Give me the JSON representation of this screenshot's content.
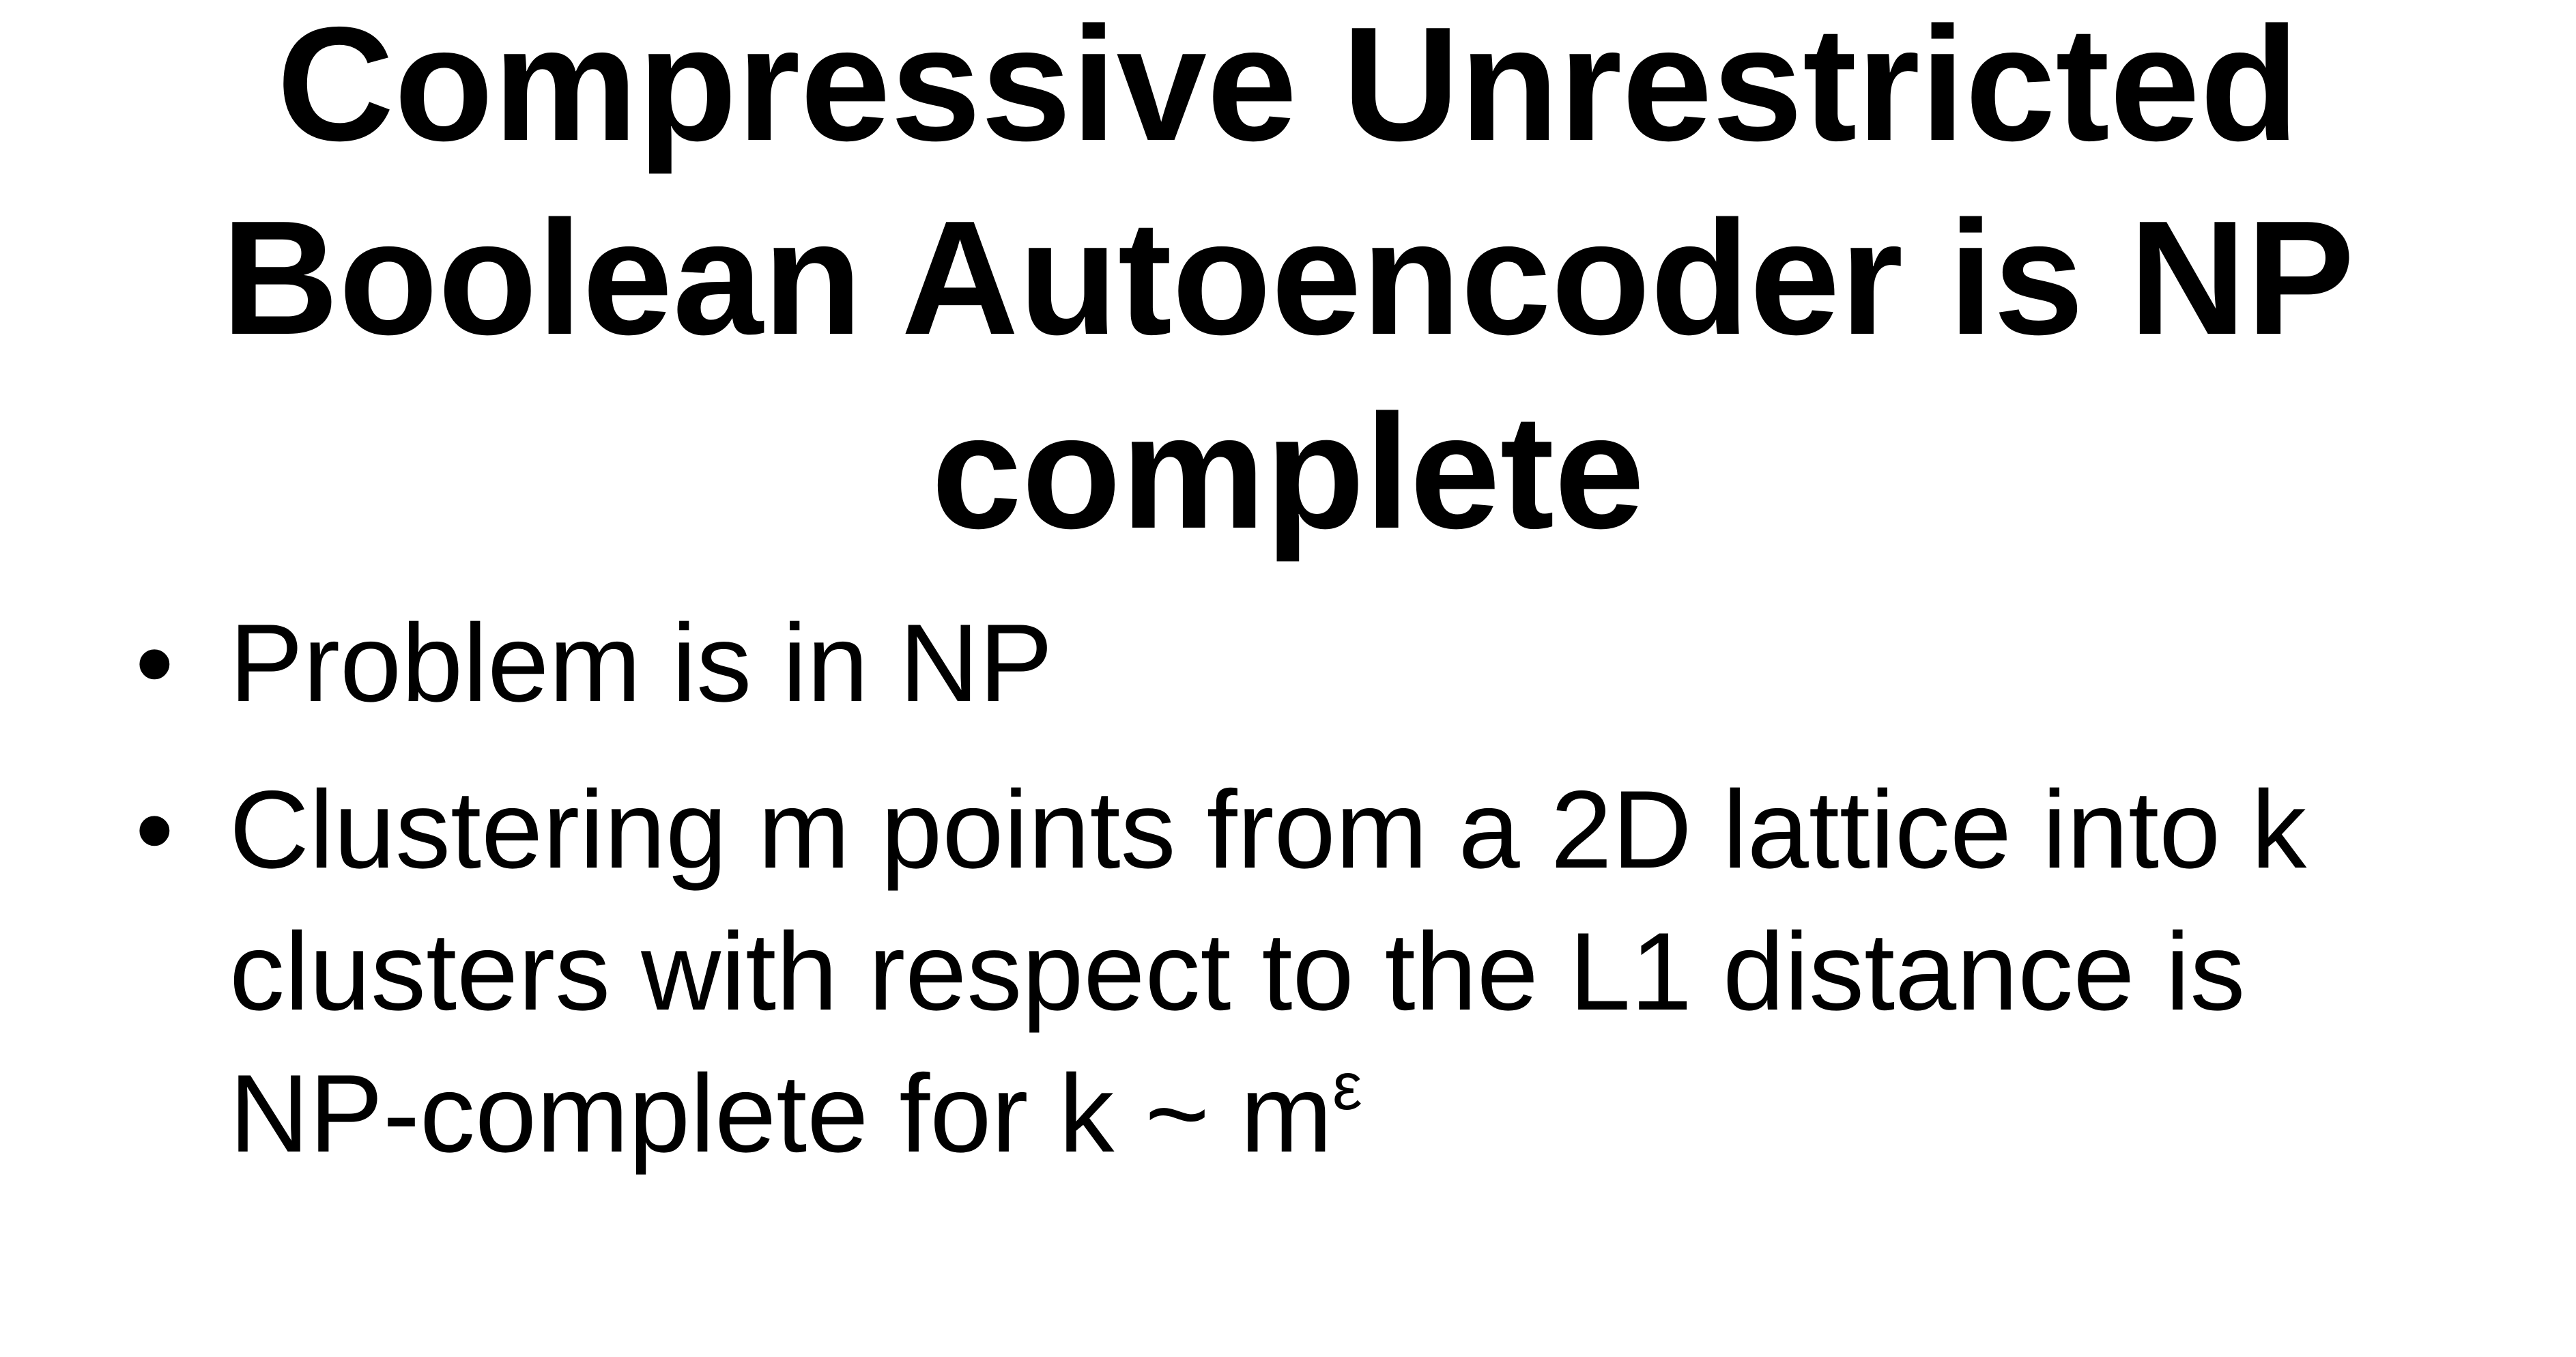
{
  "slide": {
    "title_lines": [
      "Compressive Unrestricted",
      "Boolean Autoencoder is NP",
      "complete"
    ],
    "bullet_marker": "•",
    "bullets": [
      {
        "lines": [
          "Problem is in NP"
        ]
      },
      {
        "lines": [
          "Clustering m points from a 2D lattice into k",
          "clusters with respect to the L1 distance is",
          "NP-complete for k ~ m"
        ],
        "superscript": "ε"
      }
    ]
  }
}
